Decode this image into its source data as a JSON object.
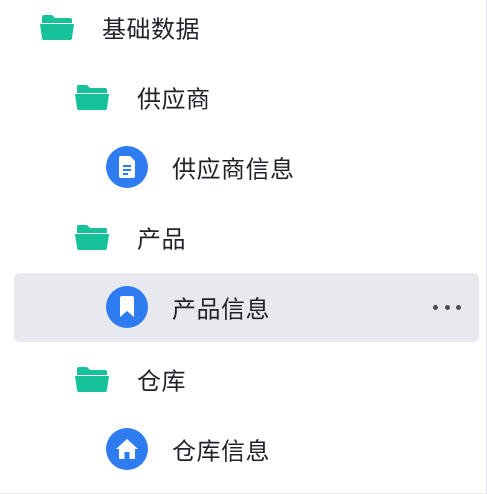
{
  "colors": {
    "folder": "#17c29b",
    "file_circle": "#2f7cf0",
    "selected_bg": "#e8e9ee",
    "text": "#1f2329"
  },
  "tree": {
    "root": {
      "label": "基础数据",
      "icon": "folder-icon"
    },
    "supplier": {
      "label": "供应商",
      "icon": "folder-icon"
    },
    "supplier_info": {
      "label": "供应商信息",
      "icon": "document-icon"
    },
    "product": {
      "label": "产品",
      "icon": "folder-icon"
    },
    "product_info": {
      "label": "产品信息",
      "icon": "bookmark-icon",
      "selected": true
    },
    "warehouse": {
      "label": "仓库",
      "icon": "folder-icon"
    },
    "warehouse_info": {
      "label": "仓库信息",
      "icon": "home-icon"
    }
  }
}
